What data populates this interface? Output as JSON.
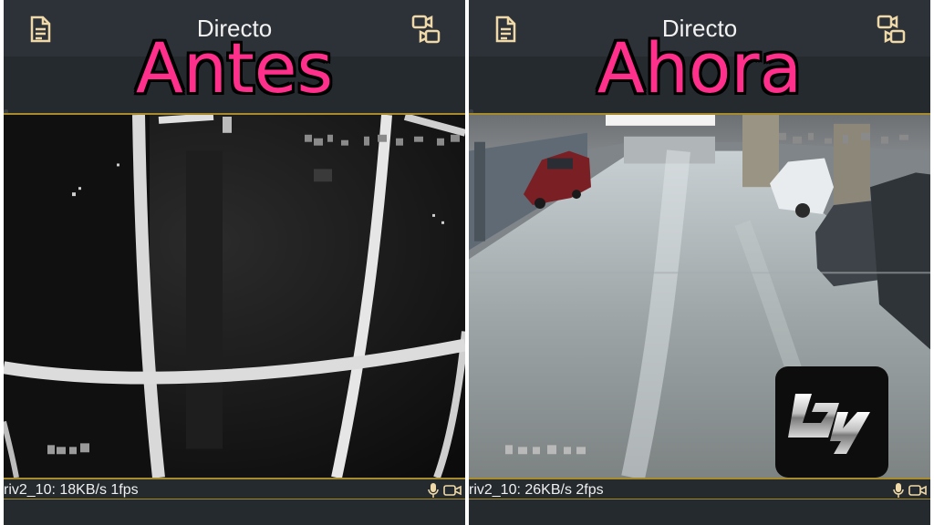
{
  "left_panel": {
    "header_title": "Directo",
    "overlay_label": "Antes",
    "stream_status": "riv2_10: 18KB/s 1fps"
  },
  "right_panel": {
    "header_title": "Directo",
    "overlay_label": "Ahora",
    "stream_status": "riv2_10: 26KB/s 2fps"
  },
  "logo": {
    "text": "by",
    "icon": "by-logo-icon"
  },
  "icons": {
    "header_left": "document-icon",
    "header_right": "video-camera-switch-icon",
    "status_mic": "microphone-icon",
    "status_video": "video-camera-icon"
  },
  "colors": {
    "app_background": "#252a2f",
    "header_background": "#2d3238",
    "video_border": "#a88b2c",
    "label_pink": "#ff2f8c"
  }
}
